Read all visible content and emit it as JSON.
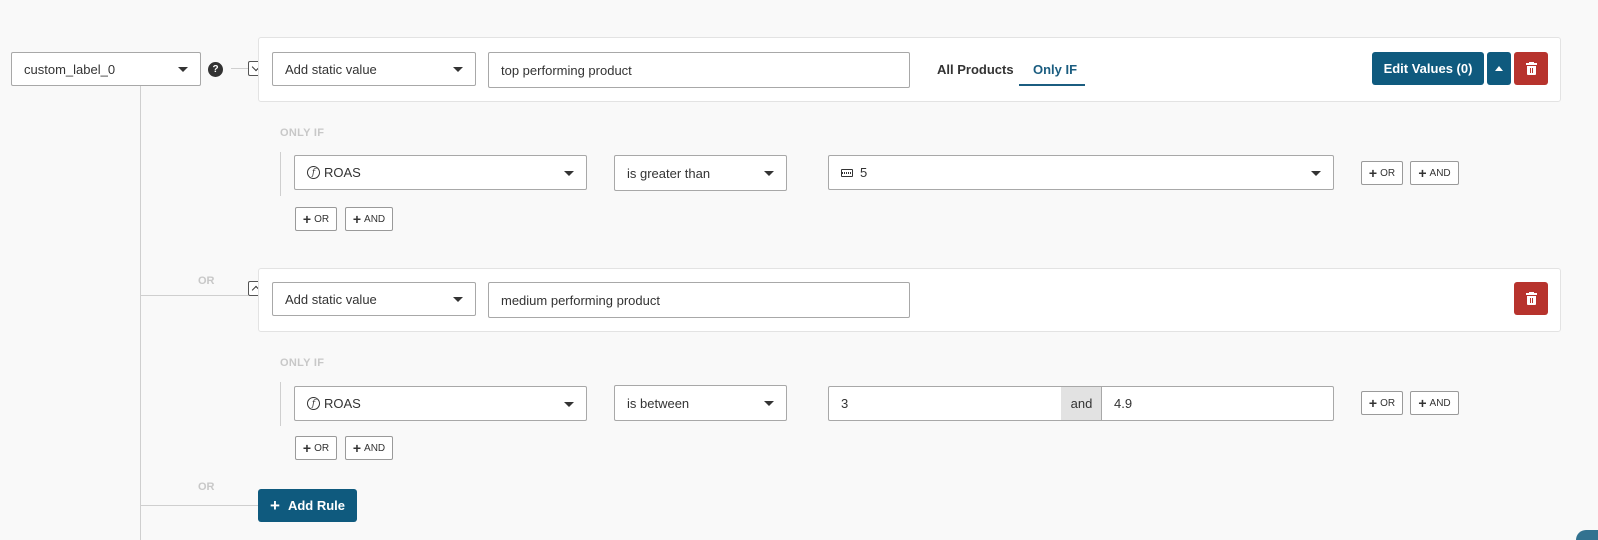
{
  "field": {
    "value": "custom_label_0",
    "help": "?"
  },
  "rules": [
    {
      "type_select": "Add static value",
      "value": "top performing product",
      "tabs": [
        "All Products",
        "Only IF"
      ],
      "edit_values_label": "Edit Values (0)",
      "only_if_label": "ONLY IF",
      "condition": {
        "field": "ROAS",
        "operator": "is greater than",
        "value": "5"
      },
      "or_label": "OR",
      "and_label": "AND"
    },
    {
      "connector": "OR",
      "type_select": "Add static value",
      "value": "medium performing product",
      "only_if_label": "ONLY IF",
      "condition": {
        "field": "ROAS",
        "operator": "is between",
        "value_from": "3",
        "between_word": "and",
        "value_to": "4.9"
      },
      "or_label": "OR",
      "and_label": "AND"
    }
  ],
  "footer": {
    "connector": "OR",
    "add_rule_label": "Add Rule"
  },
  "icons": {
    "fx": "f",
    "plus": "+"
  },
  "colors": {
    "primary": "#0f5a7e",
    "danger": "#b7332d",
    "active_tab": "#1b5d80"
  }
}
